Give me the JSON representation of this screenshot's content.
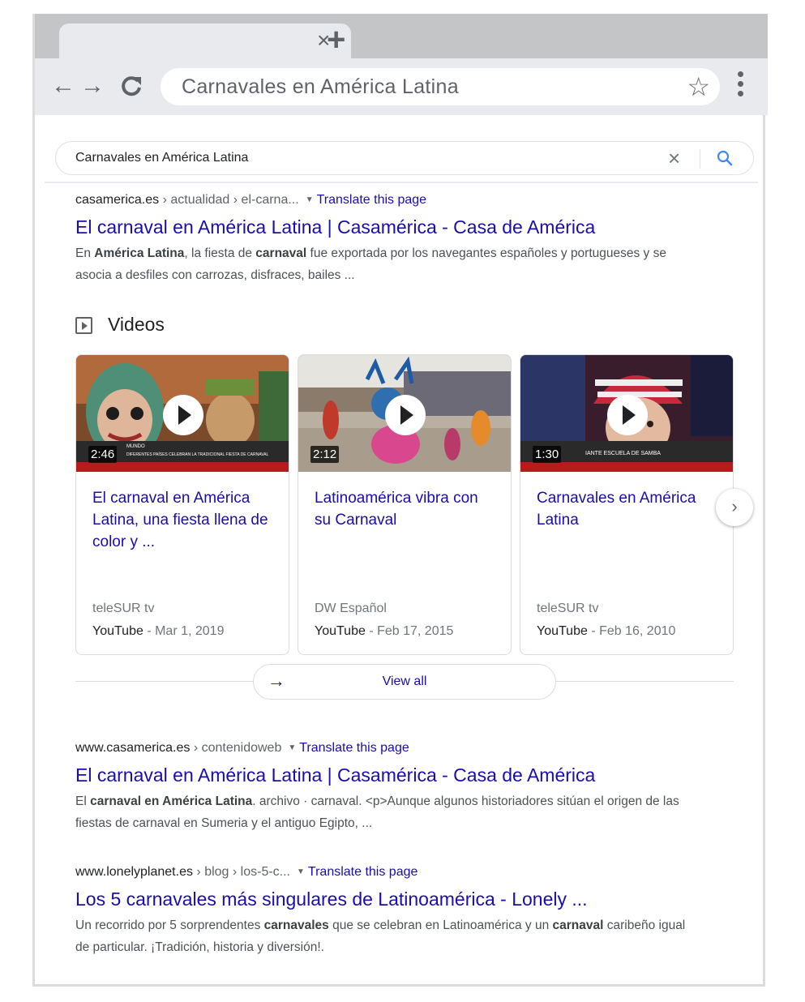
{
  "browser": {
    "tab_close": "×",
    "new_tab": "+",
    "back": "←",
    "forward": "→",
    "reload": "C",
    "omnibox_text": "Carnavales en América Latina",
    "star": "☆"
  },
  "search": {
    "query": "Carnavales en América Latina",
    "clear": "×"
  },
  "results": [
    {
      "site": "casamerica.es",
      "path": " › actualidad › el-carna...",
      "translate": "Translate this page",
      "title": "El carnaval en América Latina | Casamérica - Casa de América",
      "snippet_parts": [
        "En ",
        "América Latina",
        ", la fiesta de ",
        "carnaval",
        " fue exportada por los navegantes españoles y portugueses y se asocia a desfiles con carrozas, disfraces, bailes ..."
      ]
    },
    {
      "site": "www.casamerica.es",
      "path": " › contenidoweb",
      "translate": "Translate this page",
      "title": "El carnaval en América Latina | Casamérica - Casa de América",
      "snippet_parts": [
        "El ",
        "carnaval en América Latina",
        ". archivo · carnaval. <p>Aunque algunos historiadores sitúan el origen de las fiestas de carnaval en Sumeria y el antiguo Egipto, ..."
      ]
    },
    {
      "site": "www.lonelyplanet.es",
      "path": " › blog › los-5-c...",
      "translate": "Translate this page",
      "title": "Los 5 carnavales más singulares de Latinoamérica - Lonely ...",
      "snippet_parts": [
        "Un recorrido por 5 sorprendentes ",
        "carnavales",
        " que se celebran en Latinoamérica y un ",
        "carnaval",
        " caribeño igual de particular. ¡Tradición, historia y diversión!."
      ]
    }
  ],
  "videos": {
    "heading": "Videos",
    "items": [
      {
        "duration": "2:46",
        "title": "El carnaval en América Latina, una fiesta llena de color y ...",
        "channel": "teleSUR tv",
        "source": "YouTube",
        "date": " - Mar 1, 2019",
        "ticker_top": "MUNDO",
        "ticker_bottom": "DIFERENTES PAÍSES CELEBRAN LA TRADICIONAL FIESTA DE CARNAVAL"
      },
      {
        "duration": "2:12",
        "title": "Latinoamérica vibra con su Carnaval",
        "channel": "DW Español",
        "source": "YouTube",
        "date": " - Feb 17, 2015"
      },
      {
        "duration": "1:30",
        "title": "Carnavales en América Latina",
        "channel": "teleSUR tv",
        "source": "YouTube",
        "date": " - Feb 16, 2010",
        "ticker_top": "IANTE ESCUELA DE SAMBA"
      }
    ],
    "next": "›",
    "view_all_arrow": "→",
    "view_all": "View all"
  }
}
